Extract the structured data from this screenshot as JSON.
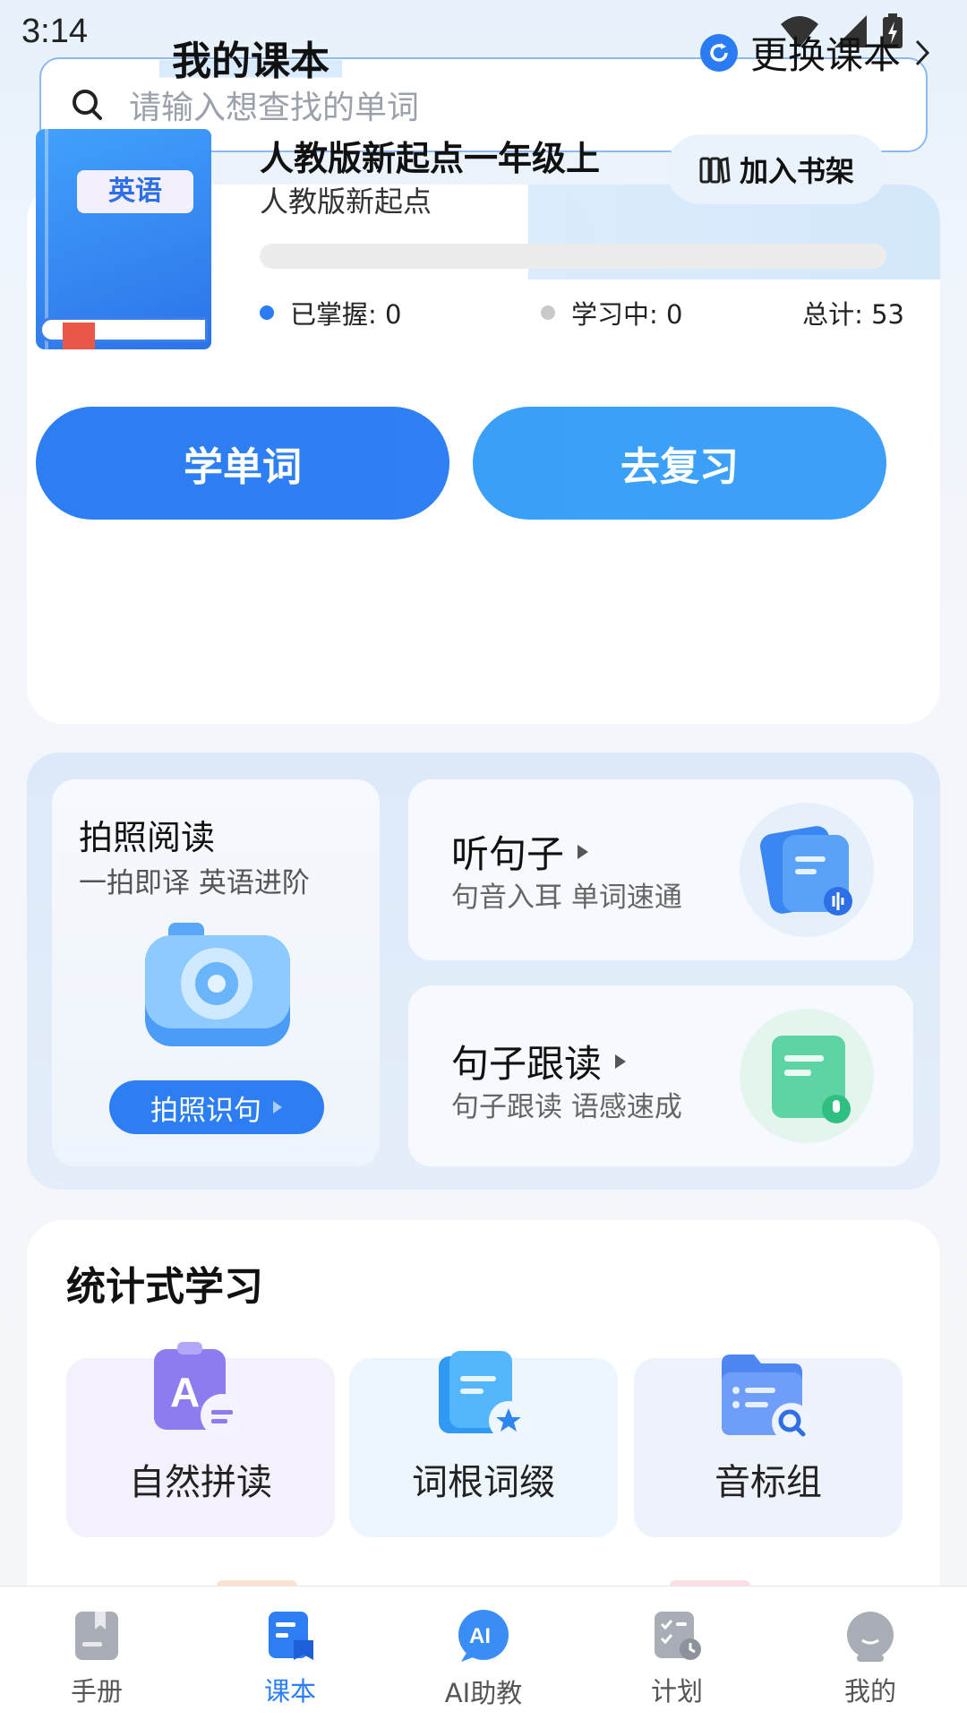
{
  "status": {
    "time": "3:14"
  },
  "search": {
    "placeholder": "请输入想查找的单词"
  },
  "textbook": {
    "section_title": "我的课本",
    "change_label": "更换课本",
    "cover_label": "英语",
    "name": "人教版新起点一年级上",
    "publisher": "人教版新起点",
    "add_shelf_label": "加入书架",
    "progress_fraction": 0,
    "mastered_label": "已掌握: 0",
    "learning_label": "学习中: 0",
    "total_label": "总计: 53",
    "learn_button": "学单词",
    "review_button": "去复习"
  },
  "features": {
    "photo": {
      "title": "拍照阅读",
      "subtitle": "一拍即译 英语进阶",
      "button": "拍照识句"
    },
    "listen": {
      "title": "听句子",
      "subtitle": "句音入耳 单词速通"
    },
    "follow": {
      "title": "句子跟读",
      "subtitle": "句子跟读 语感速成"
    }
  },
  "stats_learning": {
    "heading": "统计式学习",
    "tiles": [
      {
        "label": "自然拼读",
        "icon": "phonics-icon"
      },
      {
        "label": "词根词缀",
        "icon": "word-root-icon"
      },
      {
        "label": "音标组",
        "icon": "phonetic-icon"
      }
    ]
  },
  "bottom_nav": {
    "items": [
      {
        "label": "手册",
        "icon": "handbook-icon"
      },
      {
        "label": "课本",
        "icon": "textbook-icon",
        "active": true
      },
      {
        "label": "AI助教",
        "icon": "ai-assistant-icon"
      },
      {
        "label": "计划",
        "icon": "plan-icon"
      },
      {
        "label": "我的",
        "icon": "profile-icon"
      }
    ]
  }
}
